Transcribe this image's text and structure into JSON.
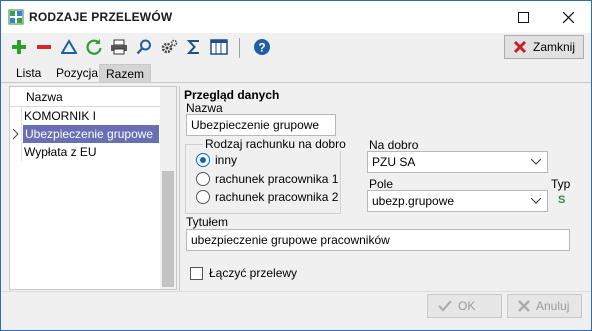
{
  "window": {
    "title": "RODZAJE PRZELEWÓW"
  },
  "toolbar": {
    "icons": [
      "add-icon",
      "remove-icon",
      "filter-icon",
      "refresh-icon",
      "print-icon",
      "search-icon",
      "settings-icon",
      "sum-icon",
      "columns-icon",
      "help-icon"
    ],
    "close_label": "Zamknij"
  },
  "tabs": [
    "Lista",
    "Pozycja",
    "Razem"
  ],
  "active_tab": "Razem",
  "grid": {
    "header": "Nazwa",
    "rows": [
      "KOMORNIK I",
      "Ubezpieczenie grupowe",
      "Wypłata z EU"
    ],
    "selected_index": 1
  },
  "details": {
    "section_title": "Przegląd danych",
    "name_label": "Nazwa",
    "name_value": "Ubezpieczenie grupowe",
    "group_label": "Rodzaj rachunku na dobro",
    "radio_options": [
      "inny",
      "rachunek pracownika 1",
      "rachunek pracownika 2"
    ],
    "radio_selected": 0,
    "na_dobro_label": "Na dobro",
    "na_dobro_value": "PZU SA",
    "pole_label": "Pole",
    "pole_value": "ubezp.grupowe",
    "typ_label": "Typ",
    "typ_value": "S",
    "tytul_label": "Tytułem",
    "tytul_value": "ubezpieczenie grupowe pracowników",
    "merge_label": "Łączyć przelewy"
  },
  "buttons": {
    "ok_label": "OK",
    "cancel_label": "Anuluj"
  },
  "colors": {
    "accent": "#0a64c8",
    "selection": "#6a6fb5",
    "add": "#2ca02c",
    "remove": "#d62728",
    "typ": "#2c8c3c"
  }
}
